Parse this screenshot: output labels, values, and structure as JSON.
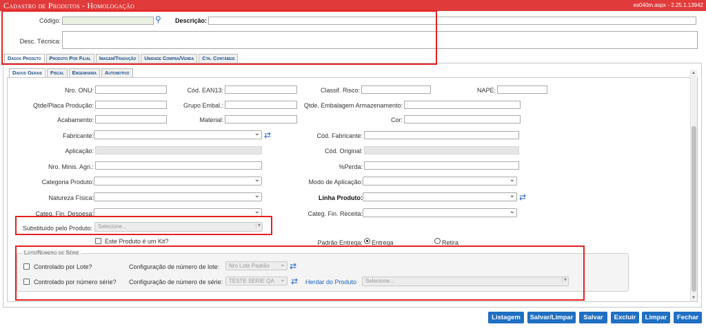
{
  "window": {
    "title": "Cadastro de Produtos  - Homologação",
    "version": "es040m.aspx - 2.25.1.13942"
  },
  "header": {
    "codigo_label": "Código:",
    "descricao_label": "Descrição:",
    "desc_tecnica_label": "Desc. Técnica:"
  },
  "main_tabs": [
    "Dados Produto",
    "Produto Por Filial",
    "Imagem/Tradução",
    "Unidade Compra/Venda",
    "Cta. Contábeis"
  ],
  "sub_tabs": [
    "Dados Gerais",
    "Fiscal",
    "Engenharia",
    "Automotivo"
  ],
  "form": {
    "nro_onu": "Nro. ONU:",
    "cod_ean13": "Cód. EAN13:",
    "classif_risco": "Classif. Risco:",
    "nape": "NAPE:",
    "qtde_placa": "Qtde/Placa Produção:",
    "grupo_embal": "Grupo Embal.:",
    "qtde_embalagem": "Qtde. Embalagem Armazenamento:",
    "acabamento": "Acabamento:",
    "material": "Material:",
    "cor": "Cor:",
    "fabricante": "Fabricante:",
    "cod_fabricante": "Cód. Fabricante:",
    "aplicacao": "Aplicação:",
    "cod_original": "Cód. Original:",
    "nro_minis_agri": "Nro. Minis. Agri.:",
    "perda": "%Perda:",
    "categoria_produto": "Categoria Produto:",
    "modo_aplicacao": "Modo de Aplicação:",
    "natureza_fisica": "Natureza Física:",
    "linha_produto": "Linha Produto:",
    "categ_fin_despesa": "Categ. Fin. Despesa:",
    "categ_fin_receita": "Categ. Fin. Receita:",
    "substituido_label": "Substituído pelo Produto:",
    "substituido_placeholder": "Selecione...",
    "kit_label": "Este Produto é um Kit?",
    "padrao_entrega_label": "Padrão Entrega:",
    "entrega": "Entrega",
    "retira": "Retira"
  },
  "lote": {
    "legend": "Lote/Número de Série",
    "controlado_lote": "Controlado por Lote?",
    "config_lote_label": "Configuração de número de lote:",
    "config_lote_value": "Nro Lote Padrão",
    "controlado_serie": "Controlado por número série?",
    "config_serie_label": "Configuração de número de série:",
    "config_serie_value": "TESTE SERIE QA",
    "herdar_label": "Herdar do Produto",
    "herdar_placeholder": "Selecione..."
  },
  "buttons": [
    "Listagem",
    "Salvar/Limpar",
    "Salvar",
    "Excluir",
    "Limpar",
    "Fechar"
  ],
  "colors": {
    "titlebar": "#e03a3a",
    "button": "#1f6fc2",
    "highlight": "#e52020",
    "link": "#1c64c8"
  }
}
